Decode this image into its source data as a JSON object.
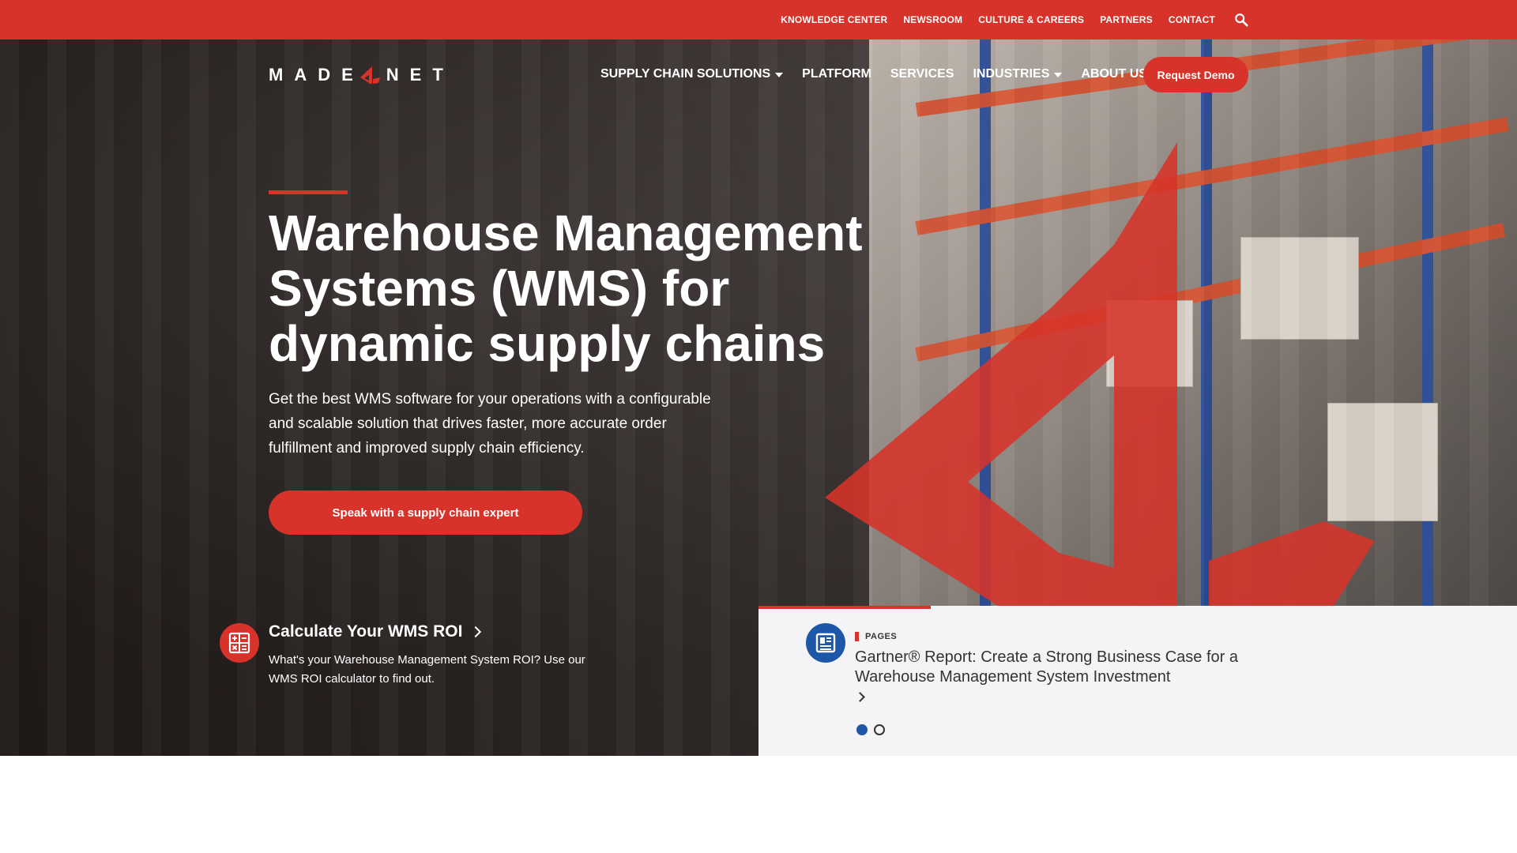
{
  "utility_nav": {
    "items": [
      "KNOWLEDGE CENTER",
      "NEWSROOM",
      "CULTURE & CAREERS",
      "PARTNERS",
      "CONTACT"
    ],
    "search_icon": "search-icon"
  },
  "brand": {
    "logo_left": "MADE",
    "logo_right": "NET",
    "accent_color": "#d7332a"
  },
  "main_nav": {
    "items": [
      {
        "label": "SUPPLY CHAIN SOLUTIONS",
        "has_dropdown": true
      },
      {
        "label": "PLATFORM",
        "has_dropdown": false
      },
      {
        "label": "SERVICES",
        "has_dropdown": false
      },
      {
        "label": "INDUSTRIES",
        "has_dropdown": true
      },
      {
        "label": "ABOUT US",
        "has_dropdown": false
      }
    ],
    "demo_label": "Request Demo"
  },
  "hero": {
    "title": "Warehouse Management Systems (WMS) for dynamic supply chains",
    "description": "Get the best WMS software for your operations with a configurable and scalable solution that drives faster, more accurate order fulfillment and improved supply chain efficiency.",
    "cta_label": "Speak with a supply chain expert"
  },
  "roi": {
    "title": "Calculate Your WMS ROI",
    "description": "What's your Warehouse Management System ROI? Use our WMS ROI calculator to find out."
  },
  "resource_card": {
    "tag": "PAGES",
    "title": "Gartner® Report: Create a Strong Business Case for a Warehouse Management System Investment",
    "slide_count": 2,
    "active_slide": 1,
    "icon_color": "#1f57a8"
  }
}
